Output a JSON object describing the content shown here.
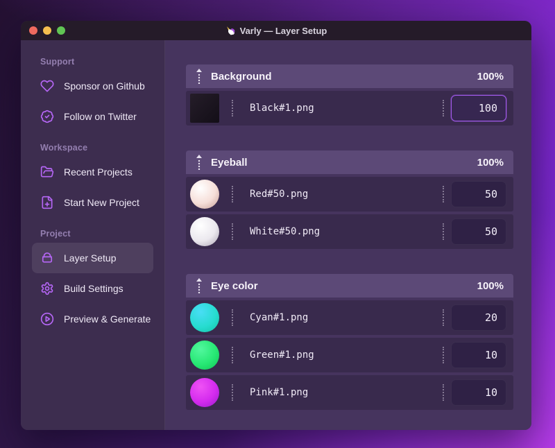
{
  "window": {
    "title": "Varly — Layer Setup",
    "app_icon": "unicorn-icon",
    "traffic_lights": {
      "close": "#ee6a5f",
      "minimize": "#f5bf4f",
      "zoom": "#61c554"
    }
  },
  "colors": {
    "accent": "#a55bf0",
    "titlebar_bg": "#251b29",
    "sidebar_bg": "#3d2d4f",
    "main_bg": "#46345e",
    "group_header_bg": "#5c4977",
    "row_bg": "#392a4d",
    "icon_purple": "#b566f5"
  },
  "sidebar": {
    "sections": [
      {
        "label": "Support",
        "items": [
          {
            "icon": "heart-icon",
            "label": "Sponsor on Github"
          },
          {
            "icon": "badge-check-icon",
            "label": "Follow on Twitter"
          }
        ]
      },
      {
        "label": "Workspace",
        "items": [
          {
            "icon": "folder-open-icon",
            "label": "Recent Projects"
          },
          {
            "icon": "file-plus-icon",
            "label": "Start New Project"
          }
        ]
      },
      {
        "label": "Project",
        "items": [
          {
            "icon": "archive-icon",
            "label": "Layer Setup",
            "active": true
          },
          {
            "icon": "gear-icon",
            "label": "Build Settings"
          },
          {
            "icon": "play-circle-icon",
            "label": "Preview & Generate"
          }
        ]
      }
    ]
  },
  "layers": {
    "groups": [
      {
        "name": "Background",
        "weight": "100%",
        "items": [
          {
            "file": "Black#1.png",
            "value": "100",
            "focused": true,
            "thumb": "square",
            "thumb_colors": [
              "#251d29",
              "#130e17"
            ]
          }
        ]
      },
      {
        "name": "Eyeball",
        "weight": "100%",
        "items": [
          {
            "file": "Red#50.png",
            "value": "50",
            "thumb": "sphere",
            "thumb_colors": [
              "#ffffff",
              "#f6ded8",
              "#c39a93"
            ]
          },
          {
            "file": "White#50.png",
            "value": "50",
            "thumb": "sphere",
            "thumb_colors": [
              "#ffffff",
              "#ebe8ee",
              "#a9a1b1"
            ]
          }
        ]
      },
      {
        "name": "Eye color",
        "weight": "100%",
        "items": [
          {
            "file": "Cyan#1.png",
            "value": "20",
            "thumb": "sphere",
            "thumb_colors": [
              "#49ddf5",
              "#27dcd0",
              "#12c2a4"
            ]
          },
          {
            "file": "Green#1.png",
            "value": "10",
            "thumb": "sphere",
            "thumb_colors": [
              "#52f79e",
              "#27e874",
              "#10c355"
            ]
          },
          {
            "file": "Pink#1.png",
            "value": "10",
            "thumb": "sphere",
            "thumb_colors": [
              "#ef52f5",
              "#d42bee",
              "#9a1bcb"
            ]
          }
        ]
      }
    ]
  }
}
